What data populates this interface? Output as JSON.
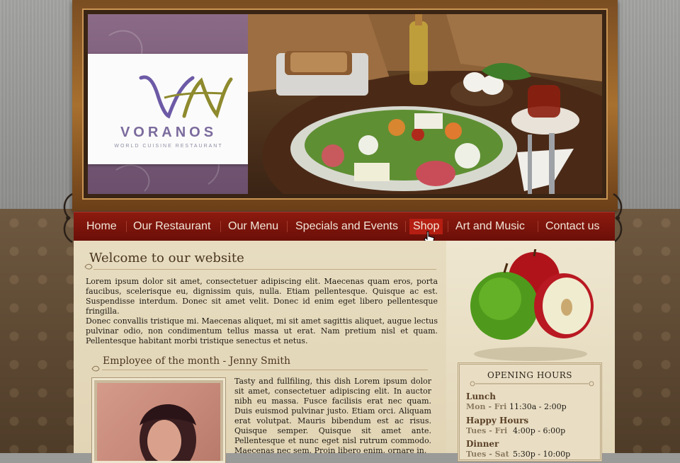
{
  "brand": {
    "name": "VORANOS",
    "tagline": "WORLD CUISINE RESTAURANT",
    "monogram": "VN",
    "colors": {
      "purple": "#7b6b9d",
      "gold": "#8e8a2e",
      "nav": "#8c1a0f",
      "nav_active": "#b51e12"
    }
  },
  "nav": {
    "items": [
      {
        "label": "Home"
      },
      {
        "label": "Our Restaurant"
      },
      {
        "label": "Our Menu"
      },
      {
        "label": "Specials and Events"
      },
      {
        "label": "Shop",
        "active": true
      },
      {
        "label": "Art and Music"
      },
      {
        "label": "Contact us"
      }
    ]
  },
  "welcome": {
    "title": "Welcome to our website",
    "para1": "Lorem ipsum dolor sit amet, consectetuer adipiscing elit. Maecenas quam eros, porta faucibus, scelerisque eu, dignissim quis, nulla. Etiam pellentesque. Quisque ac est. Suspendisse interdum. Donec sit amet velit. Donec id enim eget libero pellentesque fringilla.",
    "para2": "Donec convallis tristique mi. Maecenas aliquet, mi sit amet sagittis aliquet, augue lectus pulvinar odio, non condimentum tellus massa ut erat. Nam pretium nisl et quam. Pellentesque habitant morbi tristique senectus et netus."
  },
  "employee": {
    "title": "Employee of the month - Jenny Smith",
    "text": "Tasty and fullfiling, this dish Lorem ipsum dolor sit amet, consectetuer adipiscing elit. In auctor nibh eu massa. Fusce facilisis erat nec quam. Duis euismod pulvinar justo. Etiam orci. Aliquam erat volutpat. Mauris bibendum est ac risus. Quisque semper. Quisque sit amet ante. Pellentesque et nunc eget nisl rutrum commodo. Maecenas nec sem. Proin libero enim, ornare in,"
  },
  "hours": {
    "title": "OPENING HOURS",
    "entries": [
      {
        "label": "Lunch",
        "days": "Mon - Fri",
        "time": "11:30a - 2:00p"
      },
      {
        "label": "Happy Hours",
        "days": "Tues - Fri",
        "time": "4:00p - 6:00p"
      },
      {
        "label": "Dinner",
        "days": "Tues - Sat",
        "time": "5:30p - 10:00p"
      }
    ]
  },
  "icons": [
    "cursor-hand-icon",
    "ornament-icon",
    "apple-icon"
  ]
}
